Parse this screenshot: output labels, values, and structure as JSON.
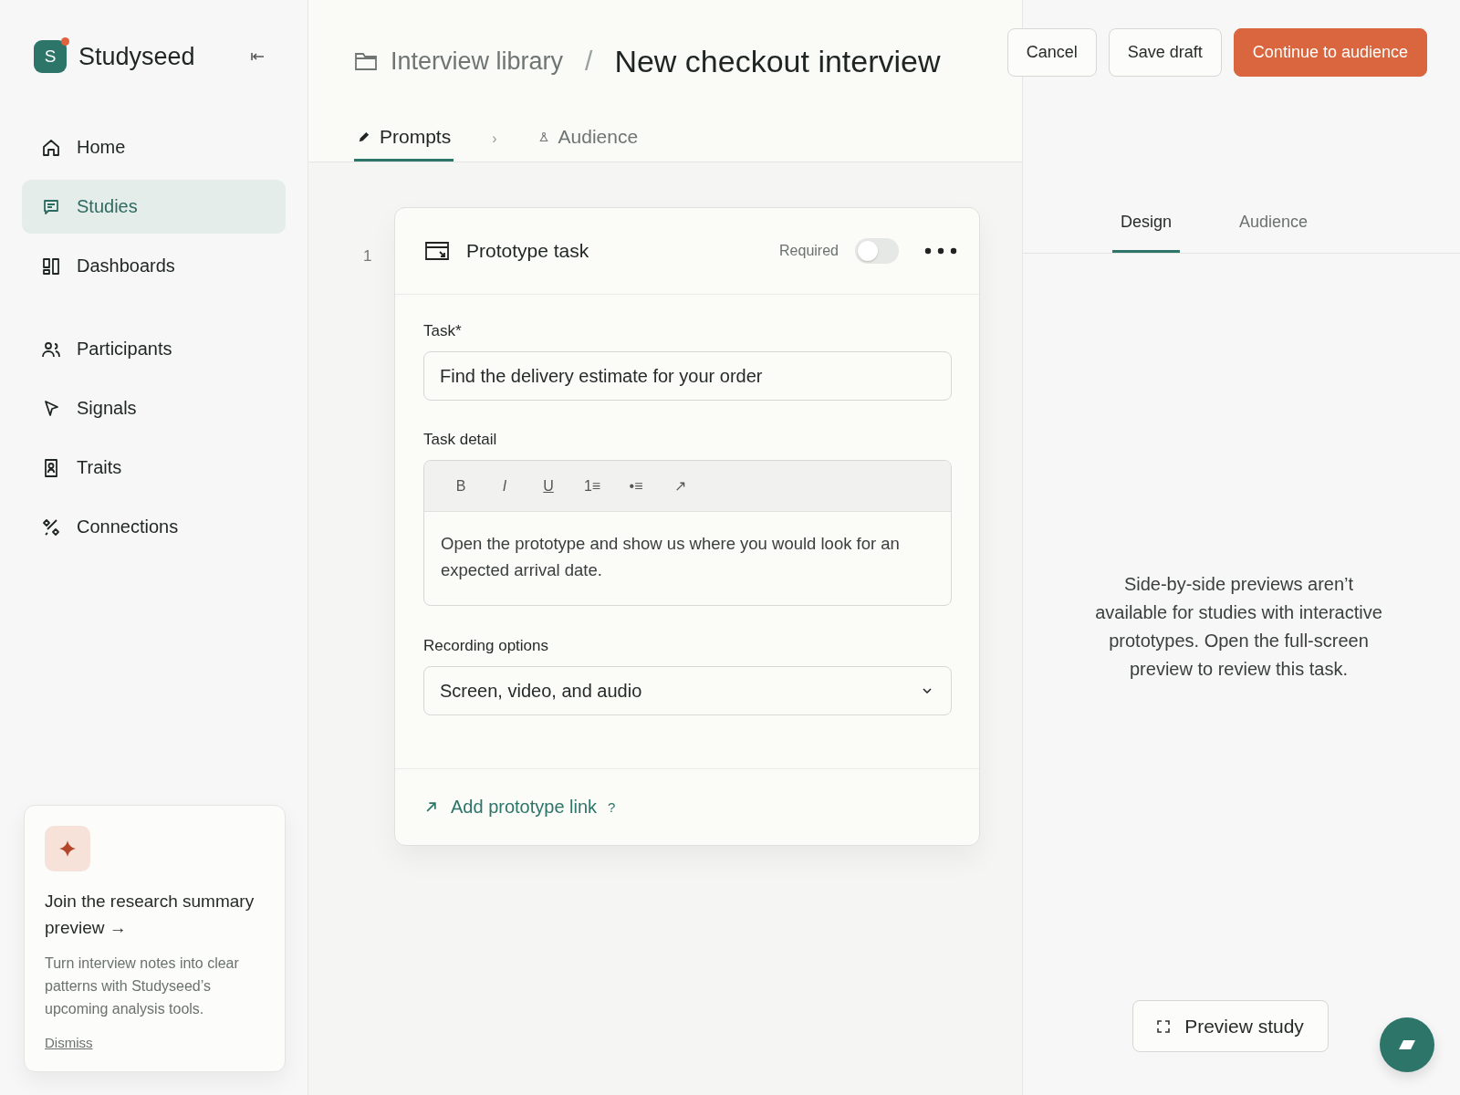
{
  "sidebar": {
    "brand": {
      "initial": "S",
      "name": "Studyseed"
    },
    "nav_groups": [
      [
        {
          "label": "Home",
          "selected": false
        },
        {
          "label": "Studies",
          "selected": true
        },
        {
          "label": "Dashboards",
          "selected": false
        }
      ],
      [
        {
          "label": "Participants",
          "selected": false
        },
        {
          "label": "Signals",
          "selected": false
        },
        {
          "label": "Traits",
          "selected": false
        },
        {
          "label": "Connections",
          "selected": false
        }
      ]
    ],
    "promo": {
      "title": "Join the research summary preview →",
      "body": "Turn interview notes into clear patterns with Studyseed’s upcoming analysis tools.",
      "dismiss": "Dismiss"
    }
  },
  "header": {
    "breadcrumb": {
      "parent": "Interview library",
      "separator": "/",
      "current": "New checkout interview"
    },
    "steps": [
      {
        "label": "Prompts",
        "selected": true
      },
      {
        "label": "Audience",
        "selected": false
      }
    ],
    "step_separator": "›",
    "actions": [
      {
        "label": "Cancel",
        "kind": "secondary"
      },
      {
        "label": "Save draft",
        "kind": "secondary"
      },
      {
        "label": "Continue to audience",
        "kind": "primary"
      }
    ]
  },
  "prompt": {
    "number": "1",
    "title": "Prototype task",
    "required_label": "Required",
    "required": false,
    "task": {
      "label": "Task*",
      "value": "Find the delivery estimate for your order"
    },
    "detail": {
      "label": "Task detail",
      "toolbar": [
        {
          "label": "B",
          "kind": "bold"
        },
        {
          "label": "I",
          "kind": "italic"
        },
        {
          "label": "U",
          "kind": "underline"
        },
        {
          "label": "1≡",
          "kind": "plain"
        },
        {
          "label": "•≡",
          "kind": "plain"
        },
        {
          "label": "↗",
          "kind": "plain"
        }
      ],
      "text": "Open the prototype and show us where you would look for an expected arrival date."
    },
    "recording": {
      "label": "Recording options",
      "value": "Screen, video, and audio"
    },
    "link": {
      "label": "Add prototype link",
      "help": "?"
    }
  },
  "preview": {
    "tabs": [
      {
        "label": "Design",
        "selected": true
      },
      {
        "label": "Audience",
        "selected": false
      }
    ],
    "message": "Side-by-side previews aren’t available for studies with interactive prototypes. Open the full-screen preview to review this task.",
    "button": "Preview study"
  }
}
